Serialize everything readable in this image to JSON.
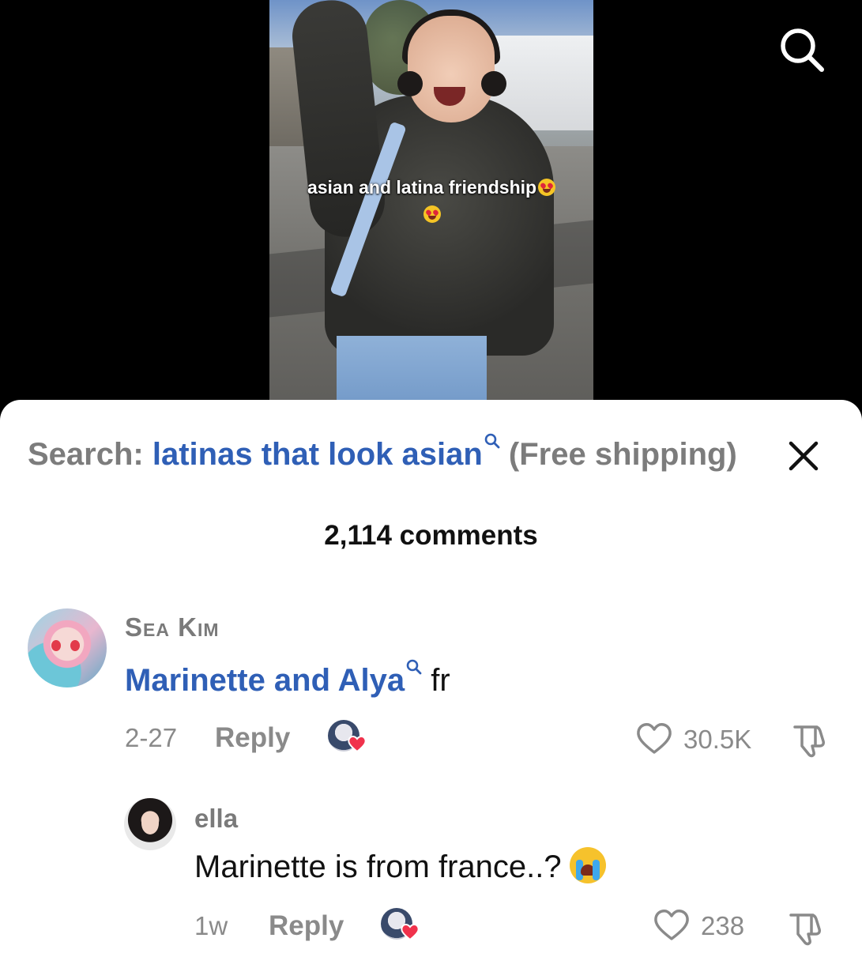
{
  "video": {
    "caption": "asian and latina friendship",
    "caption_emoji": "smiling-face-with-heart-eyes",
    "search_icon": "search-icon"
  },
  "search_bar": {
    "prefix": "Search:",
    "term": "latinas that look asian",
    "suffix": "(Free shipping)",
    "term_color": "#2f5fb6",
    "close_icon": "close-icon"
  },
  "comments_count": "2,114 comments",
  "comments": [
    {
      "username": "Sea Kim",
      "text_link": "Marinette and Alya",
      "text_rest": "fr",
      "date": "2-27",
      "reply_label": "Reply",
      "likes": "30.5K",
      "liked_by_creator": true
    },
    {
      "username": "ella",
      "text": "Marinette is from france..?",
      "text_emoji": "loudly-crying-face",
      "date": "1w",
      "reply_label": "Reply",
      "likes": "238",
      "liked_by_creator": true
    }
  ],
  "colors": {
    "link_blue": "#2f5fb6",
    "muted_gray": "#7c7c7c",
    "heart_red": "#f0324c"
  }
}
